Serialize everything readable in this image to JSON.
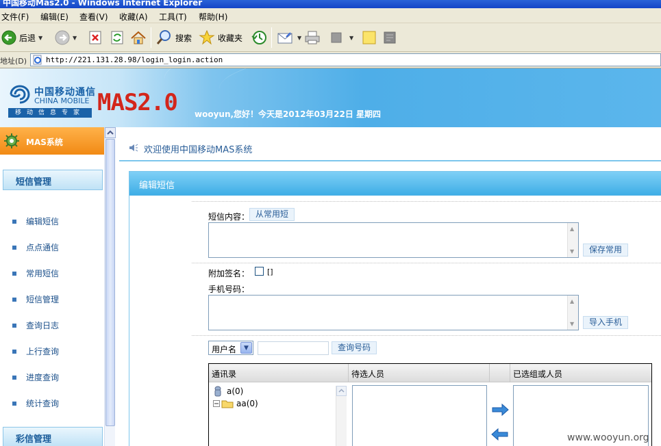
{
  "window": {
    "title": "中国移动Mas2.0 - Windows Internet Explorer"
  },
  "menubar": {
    "items": [
      "文件(F)",
      "编辑(E)",
      "查看(V)",
      "收藏(A)",
      "工具(T)",
      "帮助(H)"
    ]
  },
  "toolbar": {
    "back_label": "后退",
    "search_label": "搜索",
    "favorites_label": "收藏夹"
  },
  "address": {
    "label": "地址(D)",
    "url": "http://221.131.28.98/login_login.action"
  },
  "banner": {
    "brand_cn": "中国移动通信",
    "brand_en": "CHINA MOBILE",
    "slogan": "移动信息专家",
    "product": "MAS2.0",
    "greeting": "wooyun,您好！今天是2012年03月22日  星期四"
  },
  "sidebar": {
    "system_title": "MAS系统",
    "section1": "短信管理",
    "items": [
      "编辑短信",
      "点点通信",
      "常用短信",
      "短信管理",
      "查询日志",
      "上行查询",
      "进度查询",
      "统计查询"
    ],
    "section2": "彩信管理"
  },
  "main": {
    "welcome": "欢迎使用中国移动MAS系统",
    "panel_title": "编辑短信",
    "sms_content_label": "短信内容：",
    "from_common_button": "从常用短",
    "save_common_button": "保存常用",
    "signature_label": "附加签名：",
    "signature_value": "[]",
    "phone_label": "手机号码：",
    "import_button": "导入手机",
    "search": {
      "select_value": "用户名",
      "query_button": "查询号码"
    },
    "grid": {
      "headers": [
        "通讯录",
        "待选人员",
        "已选组或人员"
      ],
      "tree": [
        {
          "label": "a(0)"
        },
        {
          "label": "aa(0)"
        }
      ]
    }
  },
  "watermark": "www.wooyun.org",
  "colors": {
    "orange": "#f18a14",
    "blue_header": "#3eaee6",
    "mas_red": "#d3261b",
    "link_blue": "#1a4f8a"
  }
}
